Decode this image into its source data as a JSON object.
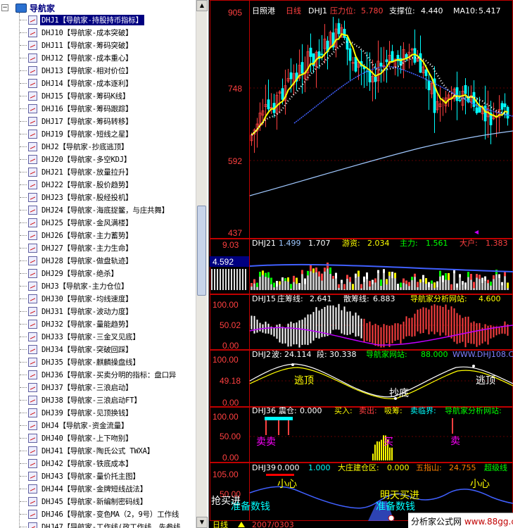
{
  "tree": {
    "root_label": "导航家",
    "expand_glyph": "−",
    "items": [
      "DHJ1【导航家-持股持币指标】",
      "DHJ10【导航家-成本突破】",
      "DHJ11【导航家-筹码突破】",
      "DHJ12【导航家-成本重心】",
      "DHJ13【导航家-相对价位】",
      "DHJ14【导航家-成本逐利】",
      "DHJ15【导航家-筹码K线】",
      "DHJ16【导航家-筹码跟踪】",
      "DHJ17【导航家-筹码转移】",
      "DHJ19【导航家-短线之星】",
      "DHJ2【导航家-抄底逃顶】",
      "DHJ20【导航家-多空KDJ】",
      "DHJ21【导航家-放量拉升】",
      "DHJ22【导航家-股价趋势】",
      "DHJ23【导航家-股经投机】",
      "DHJ24【导航家-海底捉鳖，与庄共舞】",
      "DHJ25【导航家-金风满楼】",
      "DHJ26【导航家-主力蓄势】",
      "DHJ27【导航家-主力生命】",
      "DHJ28【导航家-做盘轨迹】",
      "DHJ29【导航家-绝杀】",
      "DHJ3【导航家-主力仓位】",
      "DHJ30【导航家-均线速度】",
      "DHJ31【导航家-波动力度】",
      "DHJ32【导航家-量能趋势】",
      "DHJ33【导航家-三金叉见底】",
      "DHJ34【导航家-突破回踩】",
      "DHJ35【导航家-麒麟操盘线】",
      "DHJ36【导航家-买卖分明的指标：盘口异",
      "DHJ37【导航家-三浪启动】",
      "DHJ38【导航家-三浪启动FT】",
      "DHJ39【导航家-见顶换钱】",
      "DHJ4【导航家-资金流量】",
      "DHJ40【导航家-上下吻别】",
      "DHJ41【导航家-陶氏公式 TWXA】",
      "DHJ42【导航家-铁底成本】",
      "DHJ43【导航家-量价托主图】",
      "DHJ44【导航家-金牌短线战法】",
      "DHJ45【导航家-新编制密码线】",
      "DHJ46【导航家-变色MA（2，9号）工作线",
      "DHJ47【导航家-工作线(政工作线，先参线"
    ],
    "selected_index": 0,
    "scroll_up_glyph": "▲",
    "scroll_down_glyph": "▼"
  },
  "main_chart": {
    "stock_name": "日照港",
    "period": "日线",
    "indicator": "DHJ1",
    "resistance_label": "压力位:",
    "resistance_value": "5.780",
    "support_label": "支撑位:",
    "support_value": "4.440",
    "ma_label": "MA10:",
    "ma_value": "5.417",
    "y_ticks": [
      "905",
      "748",
      "592",
      "437"
    ],
    "colors": {
      "ma_fast": "#ffff00",
      "ma_slow": "#4060ff",
      "ma_long": "#a0c8ff"
    }
  },
  "volume_panel": {
    "indicator": "DHJ21",
    "values": [
      "1.499",
      "1.707",
      "游资:",
      "2.034",
      "主力:",
      "1.561",
      "大户:",
      "1.383"
    ],
    "y_ticks": [
      "9.03",
      "4.592"
    ]
  },
  "panel3": {
    "indicator": "DHJ15",
    "l1": "庄筹线:",
    "v1": "2.641",
    "l2": "散筹线:",
    "v2": "6.883",
    "site": "导航家分析网站:",
    "v3": "4.600",
    "y_ticks": [
      "100.00",
      "50.02",
      "0.00"
    ]
  },
  "panel4": {
    "indicator": "DHJ2",
    "l1": "波:",
    "v1": "24.114",
    "l2": "段:",
    "v2": "30.338",
    "site": "导航家网站:",
    "v3": "88.000",
    "url": "WWW.DHJ108.COM",
    "y_ticks": [
      "100.00",
      "49.18",
      "0.00"
    ],
    "ann_top1": "逃顶",
    "ann_bottom": "抄底",
    "ann_top2": "逃顶"
  },
  "panel5": {
    "indicator": "DHJ36",
    "l1": "震仓:",
    "v1": "0.000",
    "l2": "买入:",
    "l3": "卖出:",
    "l4": "吸筹:",
    "l5": "卖临界:",
    "site": "导航家分析网站:",
    "y_ticks": [
      "100.00",
      "50.00",
      "0.00"
    ],
    "ann_sell": "卖卖",
    "ann_buy": "买",
    "ann_sell2": "卖"
  },
  "panel6": {
    "indicator": "DHJ39",
    "v1": "0.000",
    "v2": "1.000",
    "l3": "大庄建仓区:",
    "v3": "0.000",
    "l4": "五指山:",
    "v4": "24.755",
    "l5": "超级线",
    "y_ticks": [
      "105.00",
      "50.00"
    ],
    "ann_xin1": "小心",
    "ann_tomorrow": "明天买进",
    "ann_prep": "准备数钱",
    "ann_prep2": "准备数钱",
    "ann_xin2": "小心",
    "ann_buy_left": "抢买进"
  },
  "status": {
    "period_label": "日线",
    "date": "2007/0303",
    "watermark_site": "分析家公式网",
    "watermark_url": "www.88gg.com"
  }
}
